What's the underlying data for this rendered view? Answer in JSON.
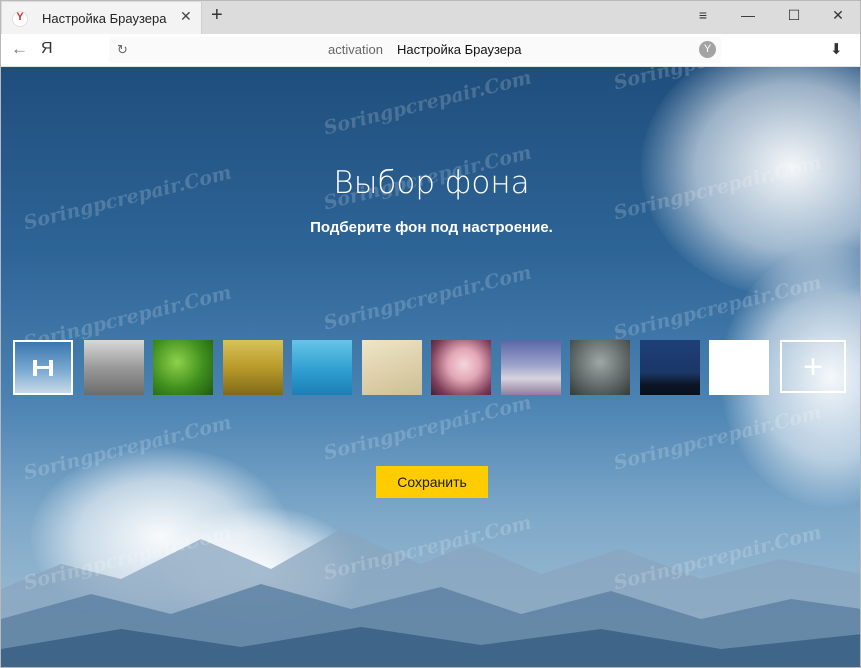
{
  "browser": {
    "tab": {
      "title": "Настройка Браузера",
      "favicon_letter": "Y",
      "close_glyph": "✕"
    },
    "new_tab_glyph": "+",
    "window_controls": {
      "menu": "≡",
      "minimize": "—",
      "maximize": "☐",
      "close": "✕"
    },
    "address": {
      "back_glyph": "←",
      "logo": "Я",
      "reload_glyph": "↻",
      "host": "activation",
      "title": "Настройка Браузера",
      "shield_glyph": "Y",
      "download_glyph": "⬇"
    }
  },
  "page": {
    "heading": "Выбор фона",
    "subheading": "Подберите фон под настроение.",
    "thumbnails": [
      {
        "name": "sky-mountains",
        "selected": true,
        "bg": "linear-gradient(180deg,#3a77b0 0%,#7aa9d0 55%,#c8dae8 100%)"
      },
      {
        "name": "fog-forest",
        "selected": false,
        "bg": "linear-gradient(180deg,#d8d8d8 0%,#9a9a9a 50%,#6c6c6c 100%)"
      },
      {
        "name": "green-grass",
        "selected": false,
        "bg": "radial-gradient(circle at 40% 40%,#8fd14a 0%,#3f8f1e 55%,#1f5a10 100%)"
      },
      {
        "name": "golden-field",
        "selected": false,
        "bg": "linear-gradient(180deg,#d6c35a 0%,#b99a2a 50%,#7f6a18 100%)"
      },
      {
        "name": "blue-water",
        "selected": false,
        "bg": "linear-gradient(180deg,#67c4e8 0%,#2f9fd0 55%,#1b7fb6 100%)"
      },
      {
        "name": "sand",
        "selected": false,
        "bg": "linear-gradient(160deg,#efe6c8 0%,#ddd0aa 55%,#cbbf97 100%)"
      },
      {
        "name": "cherry-blossom",
        "selected": false,
        "bg": "radial-gradient(circle at 55% 45%,#f4d6dc 0%,#e3a6b5 35%,#7b3c57 75%,#3d2038 100%)"
      },
      {
        "name": "snow-peak",
        "selected": false,
        "bg": "linear-gradient(180deg,#5a66a8 0%,#9aa2c9 45%,#d7d2df 70%,#8e7f9c 100%)"
      },
      {
        "name": "rain-glass",
        "selected": false,
        "bg": "radial-gradient(circle at 50% 40%,#9ea7a6 0%,#5c6664 60%,#343b3a 100%)"
      },
      {
        "name": "night-forest",
        "selected": false,
        "bg": "linear-gradient(180deg,#1e3f7a 0%,#1b3766 60%,#0c1628 80%,#081018 100%)"
      },
      {
        "name": "white",
        "selected": false,
        "bg": "#ffffff"
      }
    ],
    "add_glyph": "+",
    "save_label": "Сохранить",
    "watermark": "Soringpcrepair.Com"
  }
}
